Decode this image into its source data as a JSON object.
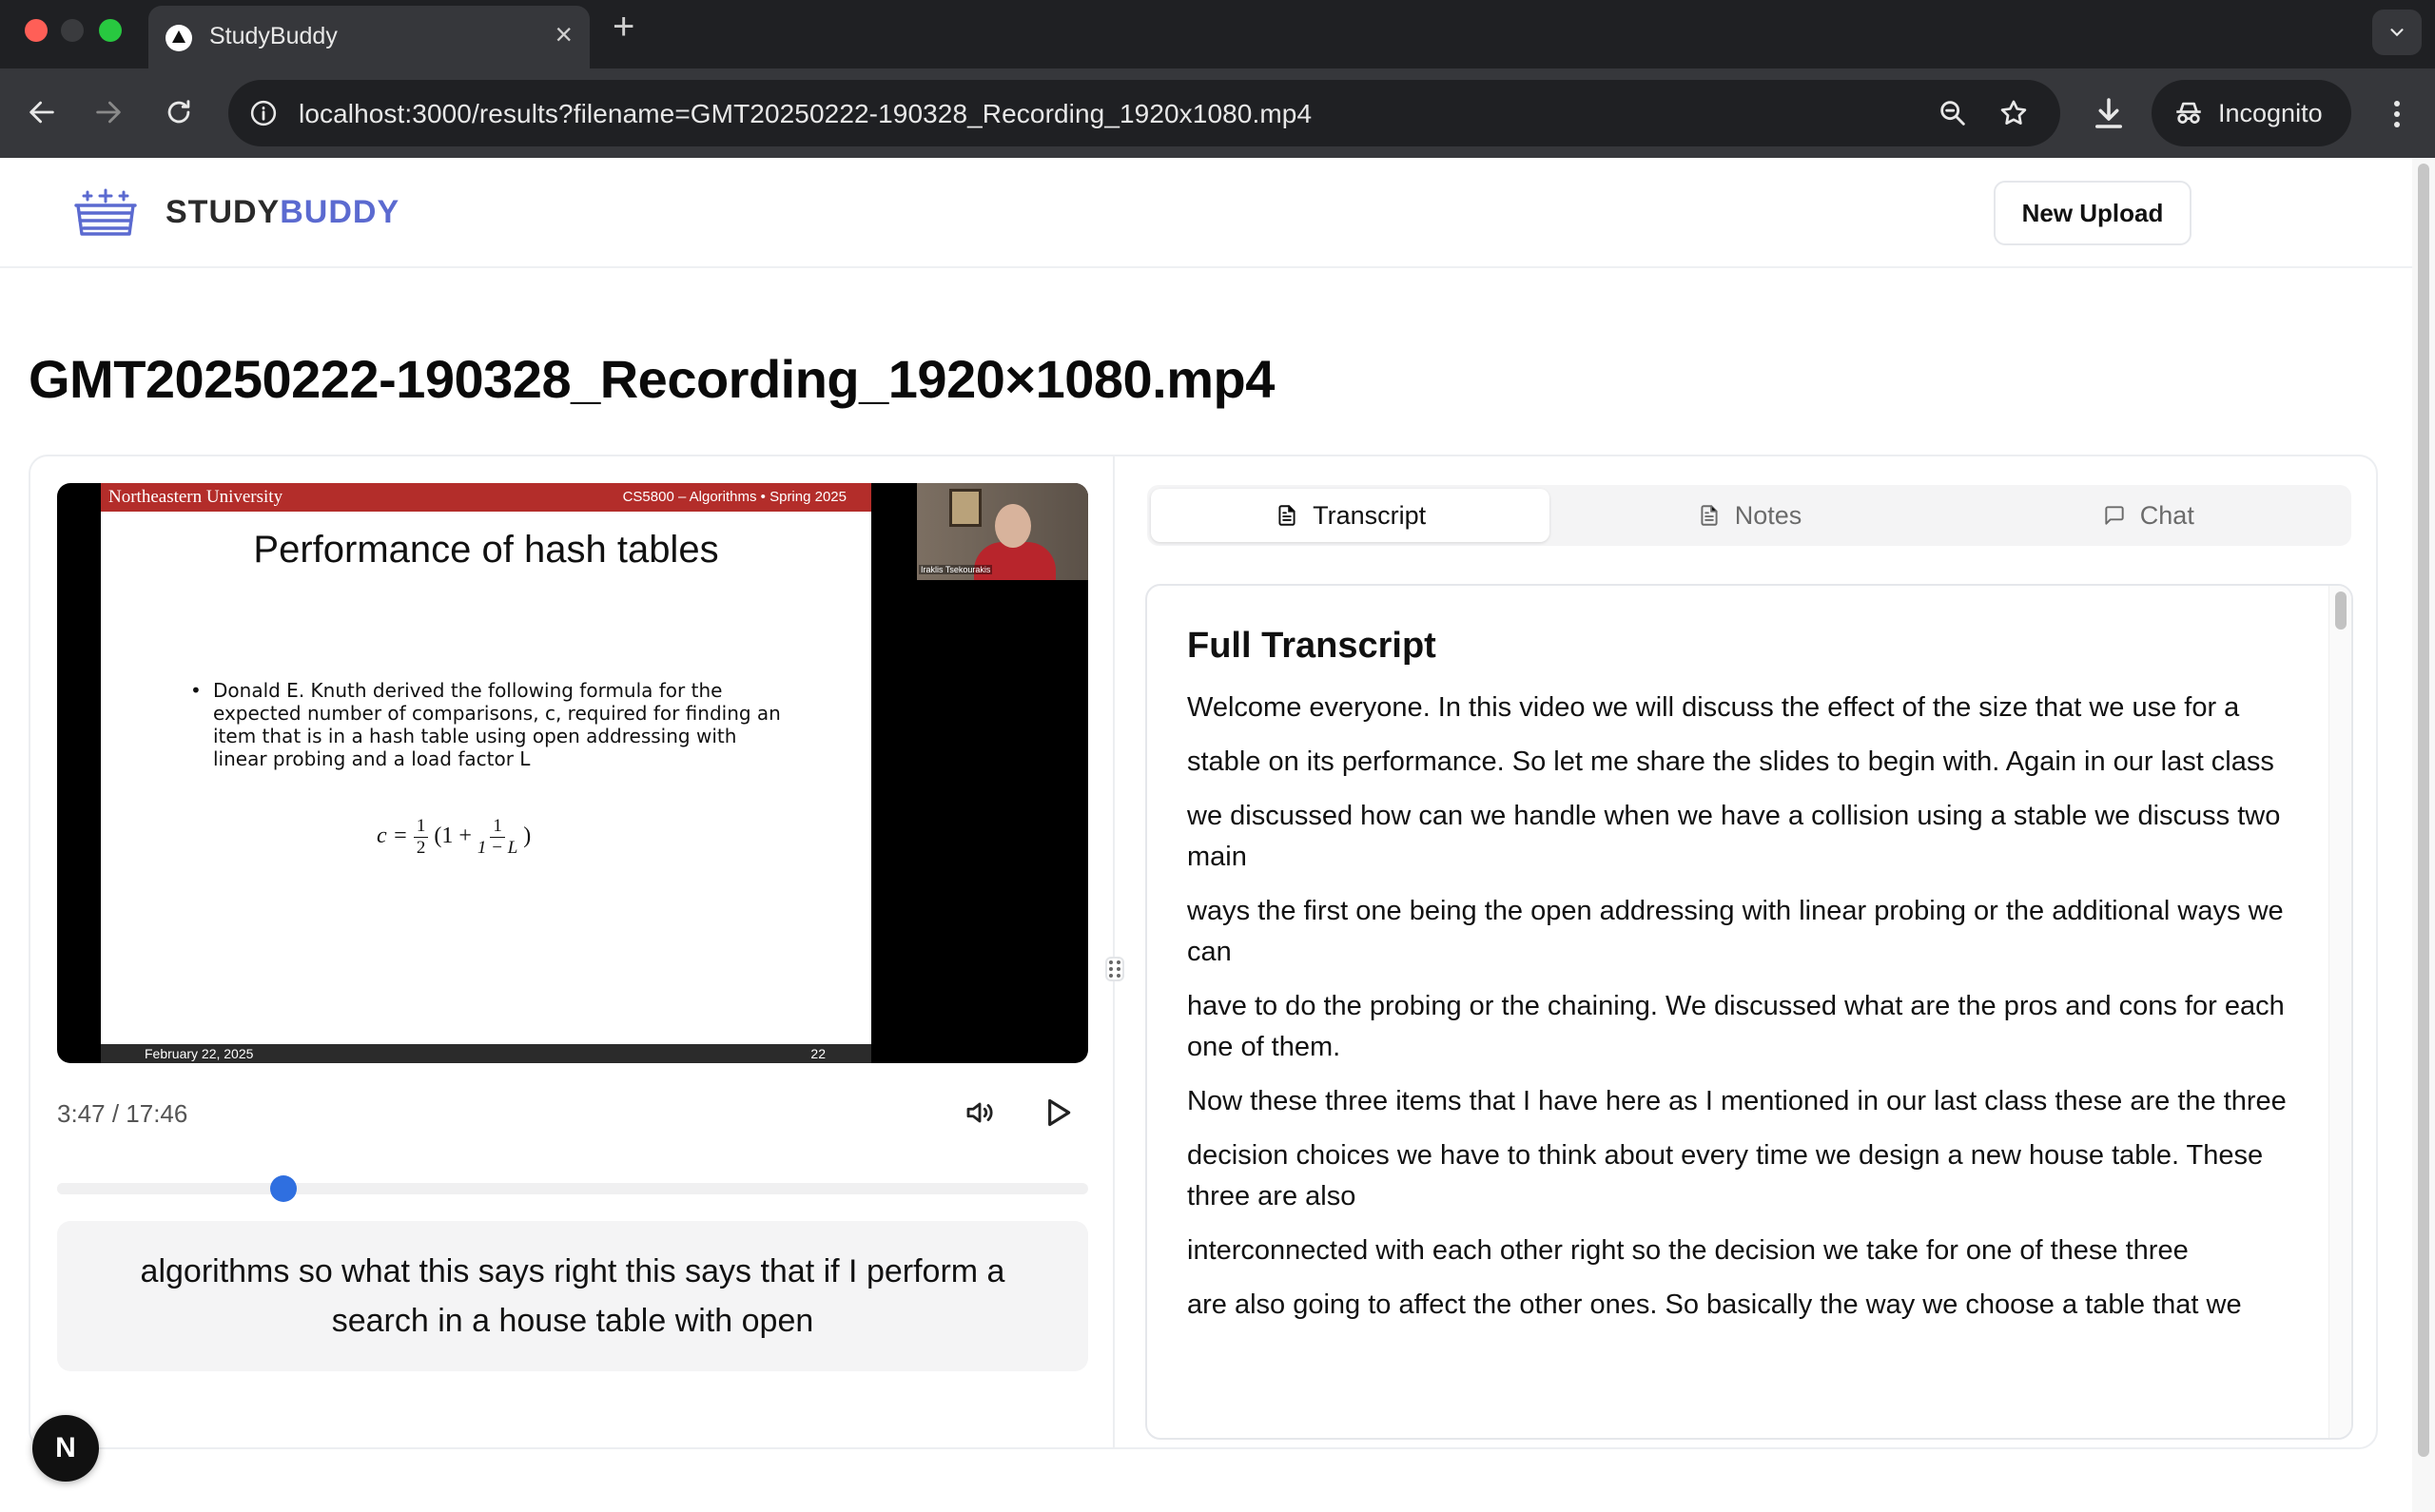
{
  "browser": {
    "tab_title": "StudyBuddy",
    "url": "localhost:3000/results?filename=GMT20250222-190328_Recording_1920x1080.mp4",
    "incognito_label": "Incognito"
  },
  "header": {
    "brand_part1": "STUDY",
    "brand_part2": "BUDDY",
    "new_upload_label": "New Upload"
  },
  "page": {
    "title": "GMT20250222-190328_Recording_1920×1080.mp4"
  },
  "video": {
    "slide_university": "Northeastern University",
    "slide_course": "CS5800 – Algorithms   •   Spring 2025",
    "slide_title": "Performance of hash tables",
    "slide_bullet": "Donald E. Knuth derived the following formula for the expected number of comparisons, c, required for finding an item that is in a hash table using open addressing with linear probing and a load factor L",
    "formula_lhs": "c = ",
    "formula_half_num": "1",
    "formula_half_den": "2",
    "formula_open": "(1 + ",
    "formula_frac_num": "1",
    "formula_frac_den": "1 − L",
    "formula_close": ")",
    "slide_date": "February 22, 2025",
    "slide_page": "22",
    "webcam_name": "Iraklis Tsekourakis",
    "time_display": "3:47 / 17:46",
    "progress": 0.22,
    "caption": "algorithms so what this says right this says that if I perform a search in a house table with open"
  },
  "tabs": [
    {
      "label": "Transcript",
      "icon": "file-text-icon",
      "active": true
    },
    {
      "label": "Notes",
      "icon": "file-lines-icon",
      "active": false
    },
    {
      "label": "Chat",
      "icon": "message-square-icon",
      "active": false
    }
  ],
  "transcript": {
    "heading": "Full Transcript",
    "paragraphs": [
      "Welcome everyone. In this video we will discuss the effect of the size that we use for a",
      "stable on its performance. So let me share the slides to begin with. Again in our last class",
      "we discussed how can we handle when we have a collision using a stable we discuss two main",
      "ways the first one being the open addressing with linear probing or the additional ways we can",
      "have to do the probing or the chaining. We discussed what are the pros and cons for each one of them.",
      "Now these three items that I have here as I mentioned in our last class these are the three",
      "decision choices we have to think about every time we design a new house table. These three are also",
      "interconnected with each other right so the decision we take for one of these three",
      "are also going to affect the other ones. So basically the way we choose a table that we"
    ]
  },
  "colors": {
    "brand_accent": "#5b6ad0",
    "seek_thumb": "#2f6fe0",
    "slide_header": "#b32d2a"
  },
  "badge": {
    "label": "N"
  }
}
